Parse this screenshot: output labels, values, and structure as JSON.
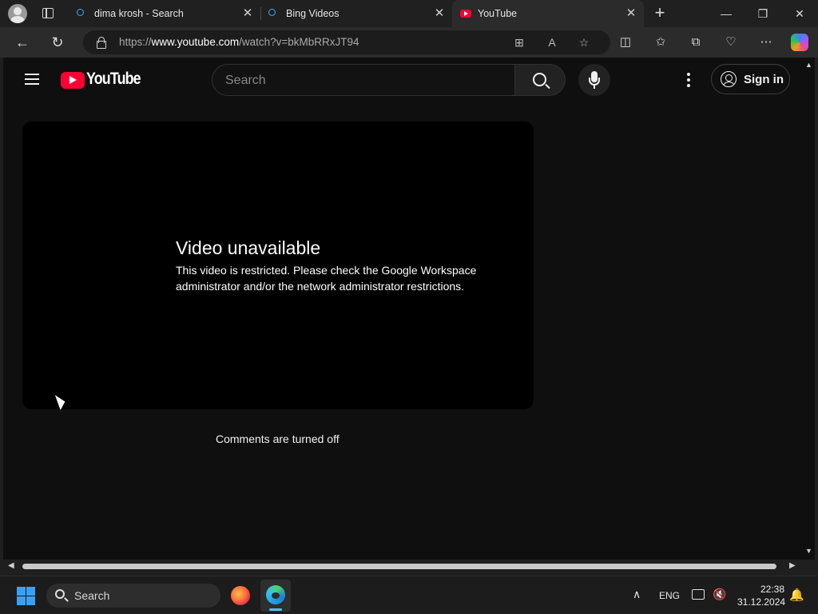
{
  "browser": {
    "tabs": [
      {
        "title": "dima krosh - Search",
        "icon": "search-favicon"
      },
      {
        "title": "Bing Videos",
        "icon": "search-favicon"
      },
      {
        "title": "YouTube",
        "icon": "youtube-favicon",
        "active": true
      }
    ],
    "close_glyph": "✕",
    "new_tab_glyph": "+",
    "window_controls": {
      "minimize": "—",
      "restore": "❐",
      "close": "✕"
    },
    "url_host": "https://www.youtube.com",
    "url_path": "/watch?v=bkMbRRxJT94",
    "url_prefix": "https://",
    "url_domain": "www.youtube.com",
    "url_rest": "/watch?v=bkMbRRxJT94"
  },
  "youtube": {
    "logo_text": "YouTube",
    "search_placeholder": "Search",
    "sign_in_label": "Sign in",
    "error_title": "Video unavailable",
    "error_message": "This video is restricted. Please check the Google Workspace administrator and/or the network administrator restrictions.",
    "comments_status": "Comments are turned off"
  },
  "taskbar": {
    "search_label": "Search",
    "language": "ENG",
    "time": "22:38",
    "date": "31.12.2024"
  },
  "colors": {
    "youtube_red": "#ff0033",
    "page_background": "#0f0f0f",
    "accent_blue": "#4cc2ff"
  }
}
